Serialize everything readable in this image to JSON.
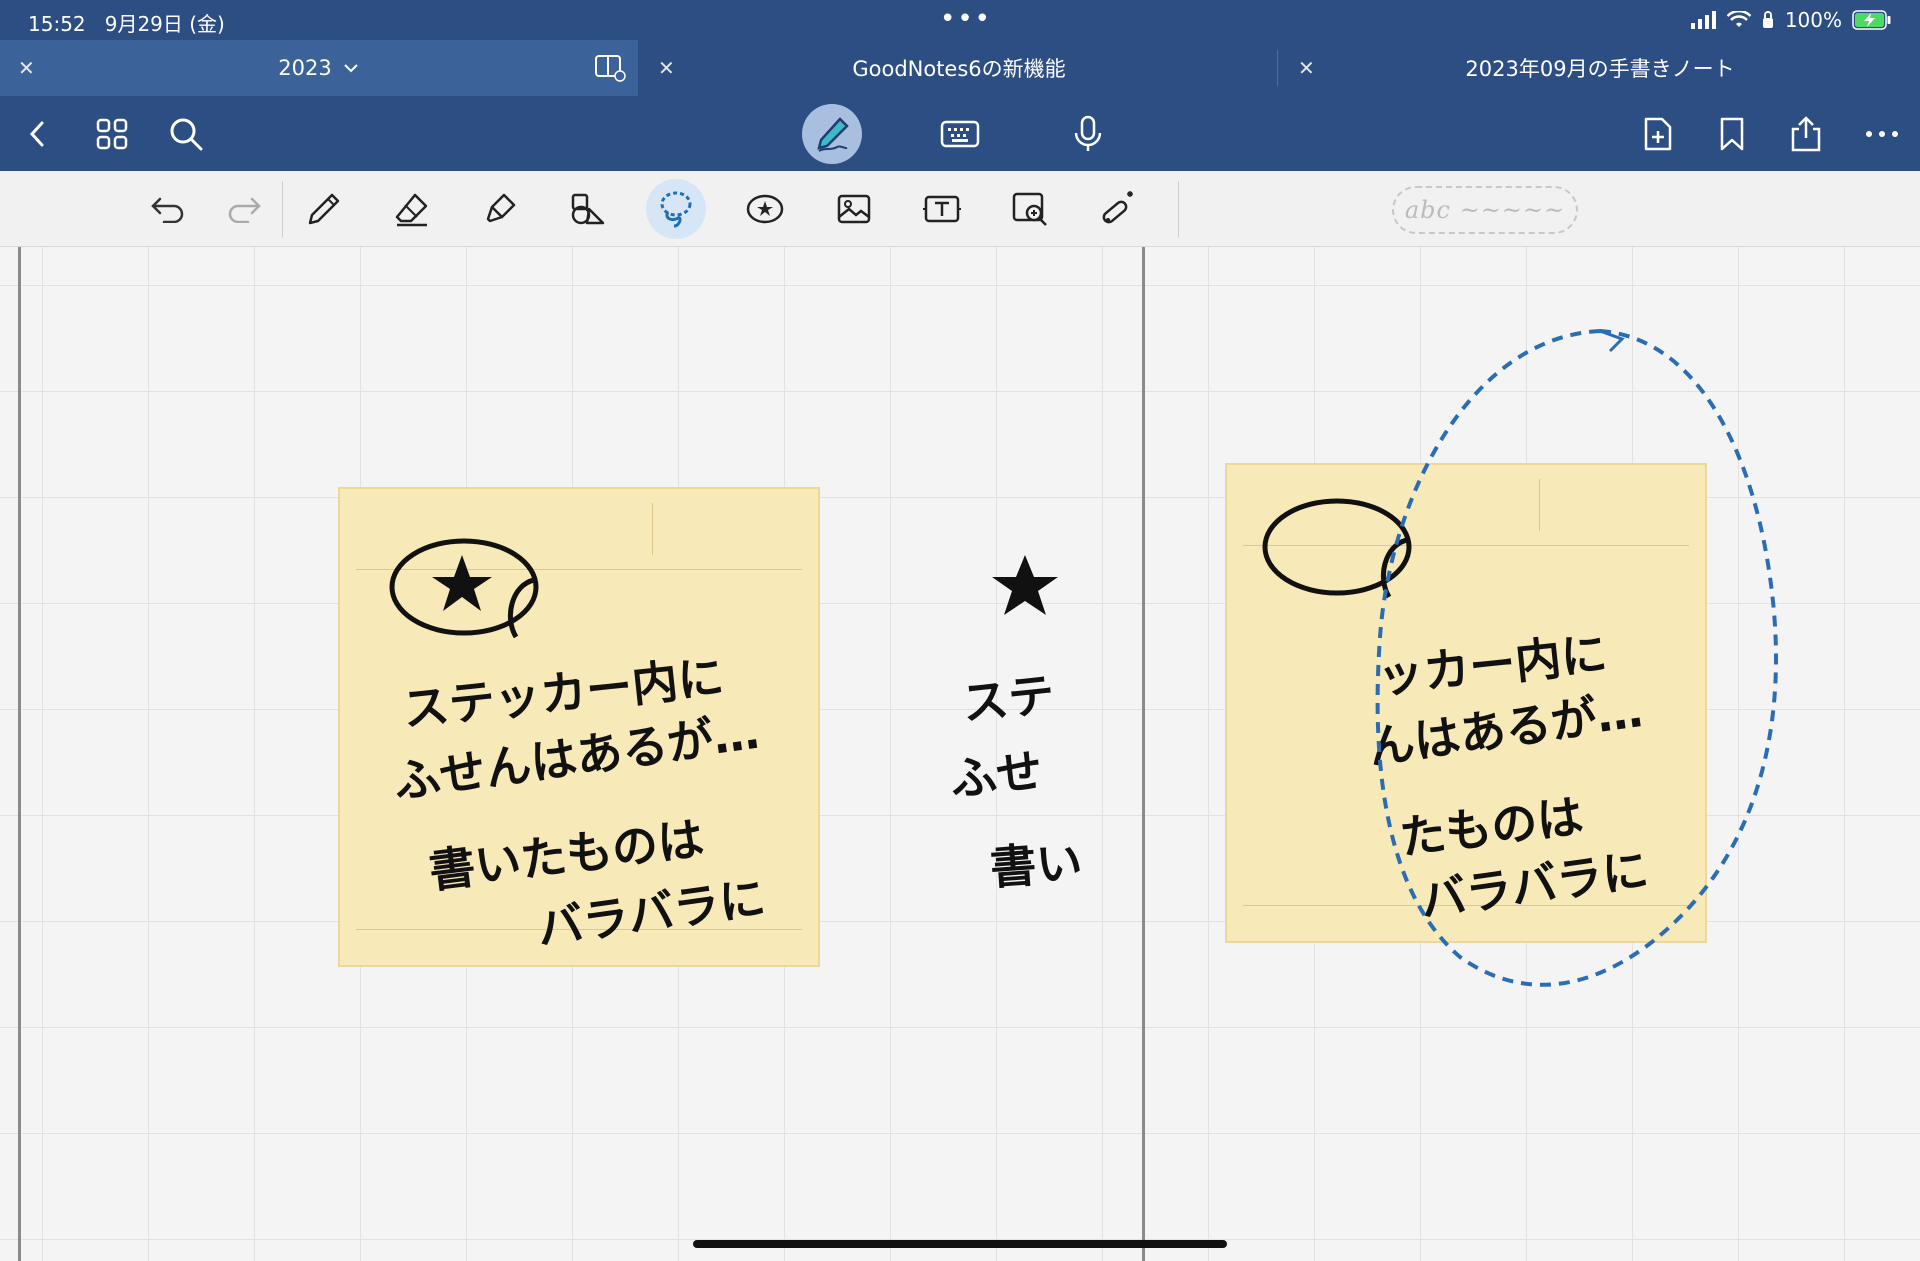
{
  "status": {
    "time": "15:52",
    "date": "9月29日 (金)",
    "battery": "100%"
  },
  "tabs": [
    {
      "label": "2023",
      "active": true
    },
    {
      "label": "GoodNotes6の新機能",
      "active": false
    },
    {
      "label": "2023年09月の手書きノート",
      "active": false
    }
  ],
  "toolbar": {
    "pen_mode_selected": true
  },
  "tools": {
    "lasso_selected": true,
    "placeholder_pill": "abc ~~~~~"
  },
  "canvas": {
    "note1": {
      "line1": "ステッカー内に",
      "line2": "ふせんはあるが…",
      "line3": "書いたものは",
      "line4": "バラバラに"
    },
    "fragment": {
      "line1": "ステ",
      "line2": "ふせ",
      "line3": "書い"
    },
    "note2": {
      "line1": "ッカー内に",
      "line2": "んはあるが…",
      "line3": "たものは",
      "line4": "バラバラに"
    }
  },
  "colors": {
    "header": "#2c4e82",
    "active_tab": "#3c629a",
    "note": "#f7e9b8",
    "lasso": "#2a6db4"
  }
}
